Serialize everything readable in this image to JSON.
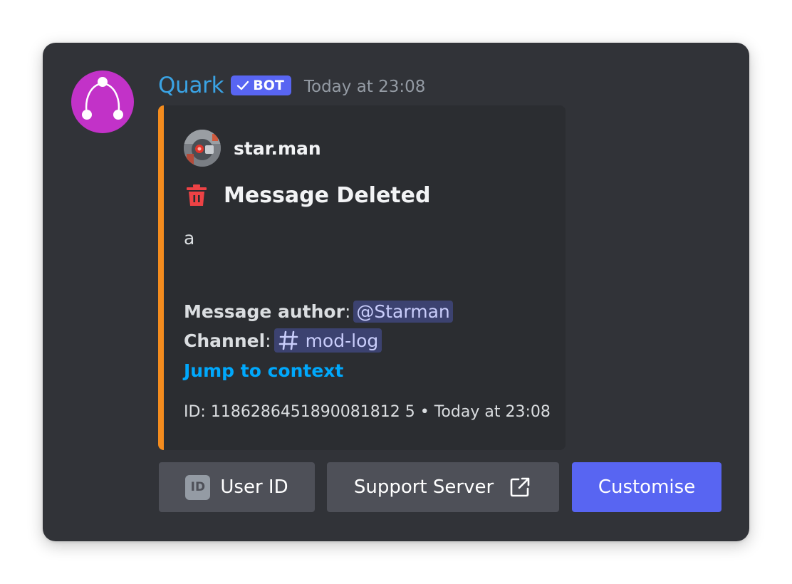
{
  "message": {
    "bot_name": "Quark",
    "bot_tag": "BOT",
    "timestamp": "Today at 23:08"
  },
  "embed": {
    "accent_color": "#f48c1e",
    "author_name": "star.man",
    "title_icon": "trash-icon",
    "title": "Message Deleted",
    "description": "a",
    "fields": {
      "author_label": "Message author",
      "author_value": "@Starman",
      "channel_label": "Channel",
      "channel_value": "mod-log",
      "separator": ":"
    },
    "link_label": "Jump to context",
    "footer": "ID: 1186286451890081812 5 • Today at 23:08"
  },
  "buttons": {
    "user_id_badge": "ID",
    "user_id_label": "User ID",
    "support_label": "Support Server",
    "customise_label": "Customise"
  },
  "colors": {
    "background": "#313338",
    "embed_background": "#2b2d31",
    "bot_name": "#3aa3e4",
    "link": "#00a8fc",
    "primary_button": "#5865f2",
    "secondary_button": "#4e5058",
    "deleted_icon": "#ed4245"
  }
}
